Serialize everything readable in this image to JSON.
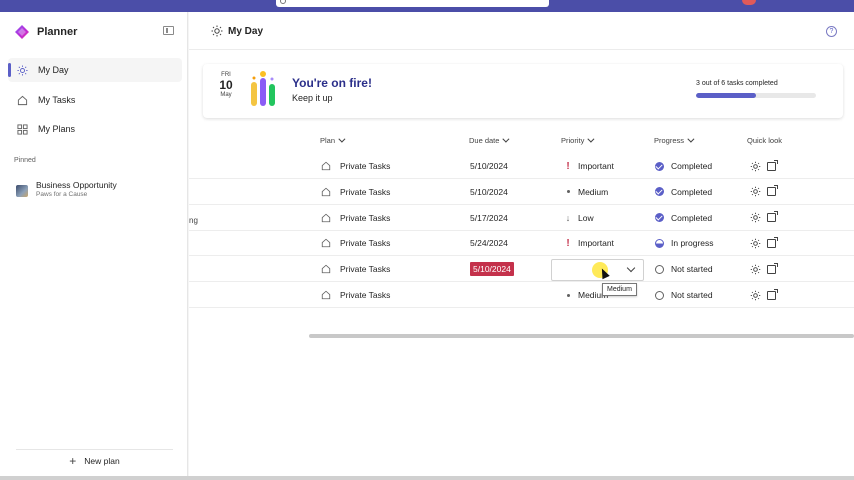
{
  "app": {
    "name": "Planner"
  },
  "sidebar": {
    "nav": [
      {
        "label": "My Day",
        "icon": "sun-icon",
        "active": true
      },
      {
        "label": "My Tasks",
        "icon": "home-icon",
        "active": false
      },
      {
        "label": "My Plans",
        "icon": "grid-icon",
        "active": false
      }
    ],
    "pinned_header": "Pinned",
    "pinned": [
      {
        "title": "Business Opportunity",
        "subtitle": "Paws for a Cause"
      }
    ],
    "new_plan_label": "New plan"
  },
  "header": {
    "title": "My Day"
  },
  "banner": {
    "day_of_week": "FRI",
    "day": "10",
    "month": "May",
    "headline": "You're on fire!",
    "subtext": "Keep it up",
    "progress_text": "3 out of 6 tasks completed",
    "progress_fraction": 0.5
  },
  "columns": {
    "plan": "Plan",
    "due": "Due date",
    "priority": "Priority",
    "progress": "Progress",
    "quick": "Quick look"
  },
  "truncated_text": "ng",
  "tasks": [
    {
      "plan": "Private Tasks",
      "due": "5/10/2024",
      "overdue": false,
      "priority": "Important",
      "priority_icon": "exclamation-icon",
      "progress": "Completed",
      "progress_icon": "completed-icon"
    },
    {
      "plan": "Private Tasks",
      "due": "5/10/2024",
      "overdue": false,
      "priority": "Medium",
      "priority_icon": "dot-icon",
      "progress": "Completed",
      "progress_icon": "completed-icon"
    },
    {
      "plan": "Private Tasks",
      "due": "5/17/2024",
      "overdue": false,
      "priority": "Low",
      "priority_icon": "arrow-down-icon",
      "progress": "Completed",
      "progress_icon": "completed-icon"
    },
    {
      "plan": "Private Tasks",
      "due": "5/24/2024",
      "overdue": false,
      "priority": "Important",
      "priority_icon": "exclamation-icon",
      "progress": "In progress",
      "progress_icon": "half-circle-icon"
    },
    {
      "plan": "Private Tasks",
      "due": "5/10/2024",
      "overdue": true,
      "priority": "Medium",
      "priority_icon": "dot-icon",
      "progress": "Not started",
      "progress_icon": "empty-circle-icon"
    },
    {
      "plan": "Private Tasks",
      "due": "",
      "overdue": false,
      "priority": "Medium",
      "priority_icon": "dot-icon",
      "progress": "Not started",
      "progress_icon": "empty-circle-icon"
    }
  ],
  "tooltip": "Medium",
  "colors": {
    "accent": "#5b5fc7",
    "overdue": "#c4314b",
    "topbar": "#4b4ea8",
    "important": "#c4314b"
  }
}
